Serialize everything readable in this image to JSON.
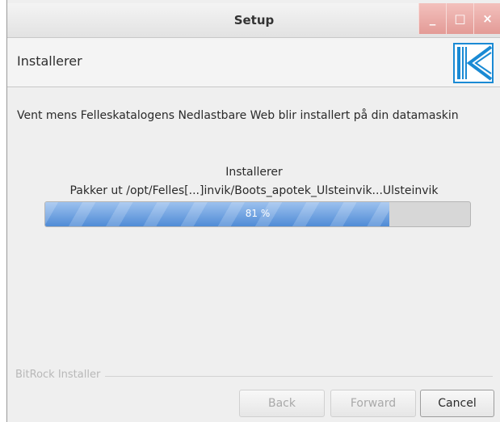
{
  "window": {
    "title": "Setup",
    "controls": {
      "minimize": "_",
      "maximize": "□",
      "close": "×"
    }
  },
  "header": {
    "title": "Installerer",
    "logo_icon": "K-logo-icon"
  },
  "main": {
    "message": "Vent mens Felleskatalogens Nedlastbare Web blir installert på din datamaskin",
    "status_label": "Installerer",
    "current_file": "Pakker ut /opt/Felles[...]invik/Boots_apotek_Ulsteinvik...Ulsteinvik",
    "progress_percent": 81,
    "progress_text": "81 %"
  },
  "footer": {
    "brand": "BitRock Installer",
    "buttons": {
      "back": "Back",
      "forward": "Forward",
      "cancel": "Cancel"
    }
  },
  "colors": {
    "progress_fill": "#5b93da",
    "window_control": "#e39b96",
    "logo_blue": "#1a8ad4"
  }
}
